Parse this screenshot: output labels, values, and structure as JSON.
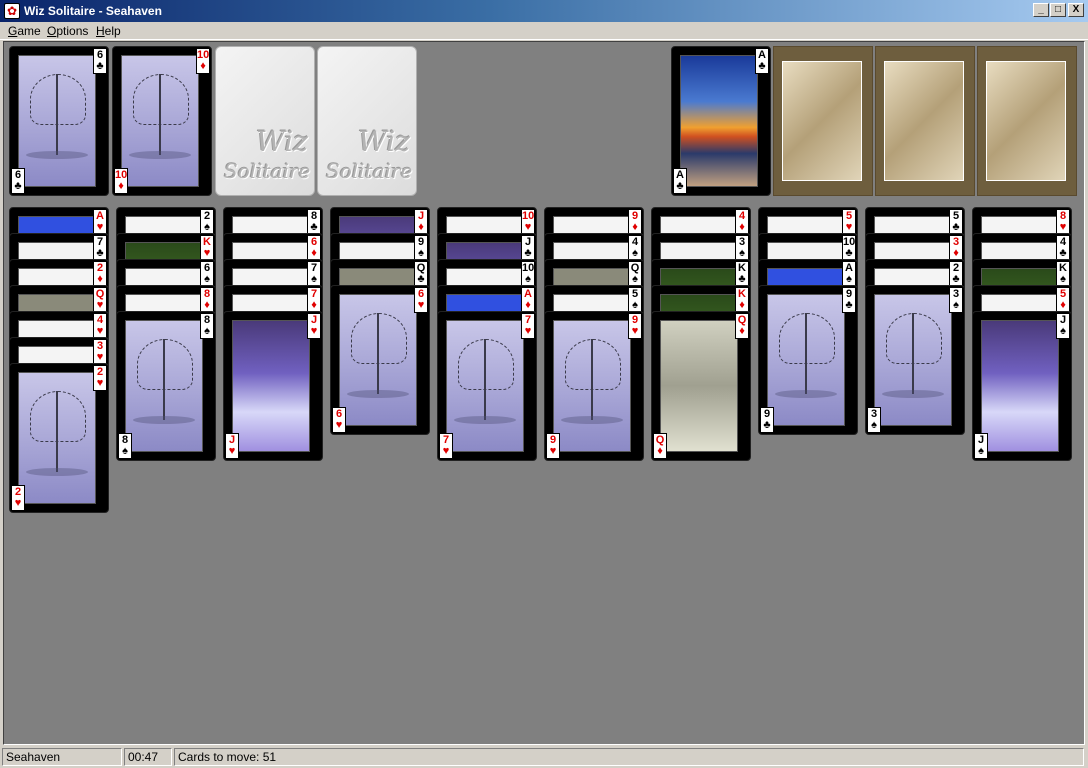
{
  "window": {
    "title": "Wiz Solitaire - Seahaven",
    "buttons": [
      "_",
      "□",
      "X"
    ]
  },
  "menu": [
    "Game",
    "Options",
    "Help"
  ],
  "freecells": [
    {
      "rank": "6",
      "suit": "♣",
      "color": "black",
      "art": "tree"
    },
    {
      "rank": "10",
      "suit": "♦",
      "color": "red",
      "art": "tree"
    },
    {
      "empty": true,
      "logo": [
        "Wiz",
        "Solitaire"
      ]
    },
    {
      "empty": true,
      "logo": [
        "Wiz",
        "Solitaire"
      ]
    }
  ],
  "foundations": [
    {
      "rank": "A",
      "suit": "♣",
      "color": "black",
      "art": "sunset"
    },
    {
      "empty": true
    },
    {
      "empty": true
    },
    {
      "empty": true
    }
  ],
  "tableau": [
    {
      "cards": [
        {
          "rank": "A",
          "suit": "♥",
          "color": "red",
          "art": "blue"
        },
        {
          "rank": "7",
          "suit": "♣",
          "color": "black",
          "art": "white"
        },
        {
          "rank": "2",
          "suit": "♦",
          "color": "red",
          "art": "white"
        },
        {
          "rank": "Q",
          "suit": "♥",
          "color": "red",
          "art": "gravel"
        },
        {
          "rank": "4",
          "suit": "♥",
          "color": "red",
          "art": "white"
        },
        {
          "rank": "3",
          "suit": "♥",
          "color": "red",
          "art": "white"
        },
        {
          "rank": "2",
          "suit": "♥",
          "color": "red",
          "art": "tree"
        }
      ]
    },
    {
      "cards": [
        {
          "rank": "2",
          "suit": "♠",
          "color": "black",
          "art": "white"
        },
        {
          "rank": "K",
          "suit": "♥",
          "color": "red",
          "art": "green"
        },
        {
          "rank": "6",
          "suit": "♠",
          "color": "black",
          "art": "white"
        },
        {
          "rank": "8",
          "suit": "♦",
          "color": "red",
          "art": "white"
        },
        {
          "rank": "8",
          "suit": "♠",
          "color": "black",
          "art": "tree"
        }
      ]
    },
    {
      "cards": [
        {
          "rank": "8",
          "suit": "♣",
          "color": "black",
          "art": "white"
        },
        {
          "rank": "6",
          "suit": "♦",
          "color": "red",
          "art": "white"
        },
        {
          "rank": "7",
          "suit": "♠",
          "color": "black",
          "art": "white"
        },
        {
          "rank": "7",
          "suit": "♦",
          "color": "red",
          "art": "white"
        },
        {
          "rank": "J",
          "suit": "♥",
          "color": "red",
          "art": "snow"
        }
      ]
    },
    {
      "cards": [
        {
          "rank": "J",
          "suit": "♦",
          "color": "red",
          "art": "snow"
        },
        {
          "rank": "9",
          "suit": "♠",
          "color": "black",
          "art": "white"
        },
        {
          "rank": "Q",
          "suit": "♣",
          "color": "black",
          "art": "gravel"
        },
        {
          "rank": "6",
          "suit": "♥",
          "color": "red",
          "art": "tree"
        }
      ]
    },
    {
      "cards": [
        {
          "rank": "10",
          "suit": "♥",
          "color": "red",
          "art": "white"
        },
        {
          "rank": "J",
          "suit": "♣",
          "color": "black",
          "art": "snow"
        },
        {
          "rank": "10",
          "suit": "♠",
          "color": "black",
          "art": "white"
        },
        {
          "rank": "A",
          "suit": "♦",
          "color": "red",
          "art": "blue"
        },
        {
          "rank": "7",
          "suit": "♥",
          "color": "red",
          "art": "tree"
        }
      ]
    },
    {
      "cards": [
        {
          "rank": "9",
          "suit": "♦",
          "color": "red",
          "art": "white"
        },
        {
          "rank": "4",
          "suit": "♠",
          "color": "black",
          "art": "white"
        },
        {
          "rank": "Q",
          "suit": "♠",
          "color": "black",
          "art": "gravel"
        },
        {
          "rank": "5",
          "suit": "♠",
          "color": "black",
          "art": "white"
        },
        {
          "rank": "9",
          "suit": "♥",
          "color": "red",
          "art": "tree"
        }
      ]
    },
    {
      "cards": [
        {
          "rank": "4",
          "suit": "♦",
          "color": "red",
          "art": "white"
        },
        {
          "rank": "3",
          "suit": "♠",
          "color": "black",
          "art": "white"
        },
        {
          "rank": "K",
          "suit": "♣",
          "color": "black",
          "art": "green"
        },
        {
          "rank": "K",
          "suit": "♦",
          "color": "red",
          "art": "green"
        },
        {
          "rank": "Q",
          "suit": "♦",
          "color": "red",
          "art": "path"
        }
      ]
    },
    {
      "cards": [
        {
          "rank": "5",
          "suit": "♥",
          "color": "red",
          "art": "white"
        },
        {
          "rank": "10",
          "suit": "♣",
          "color": "black",
          "art": "white"
        },
        {
          "rank": "A",
          "suit": "♠",
          "color": "black",
          "art": "blue"
        },
        {
          "rank": "9",
          "suit": "♣",
          "color": "black",
          "art": "tree"
        }
      ]
    },
    {
      "cards": [
        {
          "rank": "5",
          "suit": "♣",
          "color": "black",
          "art": "white"
        },
        {
          "rank": "3",
          "suit": "♦",
          "color": "red",
          "art": "white"
        },
        {
          "rank": "2",
          "suit": "♣",
          "color": "black",
          "art": "white"
        },
        {
          "rank": "3",
          "suit": "♠",
          "color": "black",
          "art": "tree"
        }
      ]
    },
    {
      "cards": [
        {
          "rank": "8",
          "suit": "♥",
          "color": "red",
          "art": "white"
        },
        {
          "rank": "4",
          "suit": "♣",
          "color": "black",
          "art": "white"
        },
        {
          "rank": "K",
          "suit": "♠",
          "color": "black",
          "art": "green"
        },
        {
          "rank": "5",
          "suit": "♦",
          "color": "red",
          "art": "white"
        },
        {
          "rank": "J",
          "suit": "♠",
          "color": "black",
          "art": "snow"
        }
      ]
    }
  ],
  "status": {
    "game": "Seahaven",
    "time": "00:47",
    "cards_to_move": "Cards to move: 51"
  }
}
